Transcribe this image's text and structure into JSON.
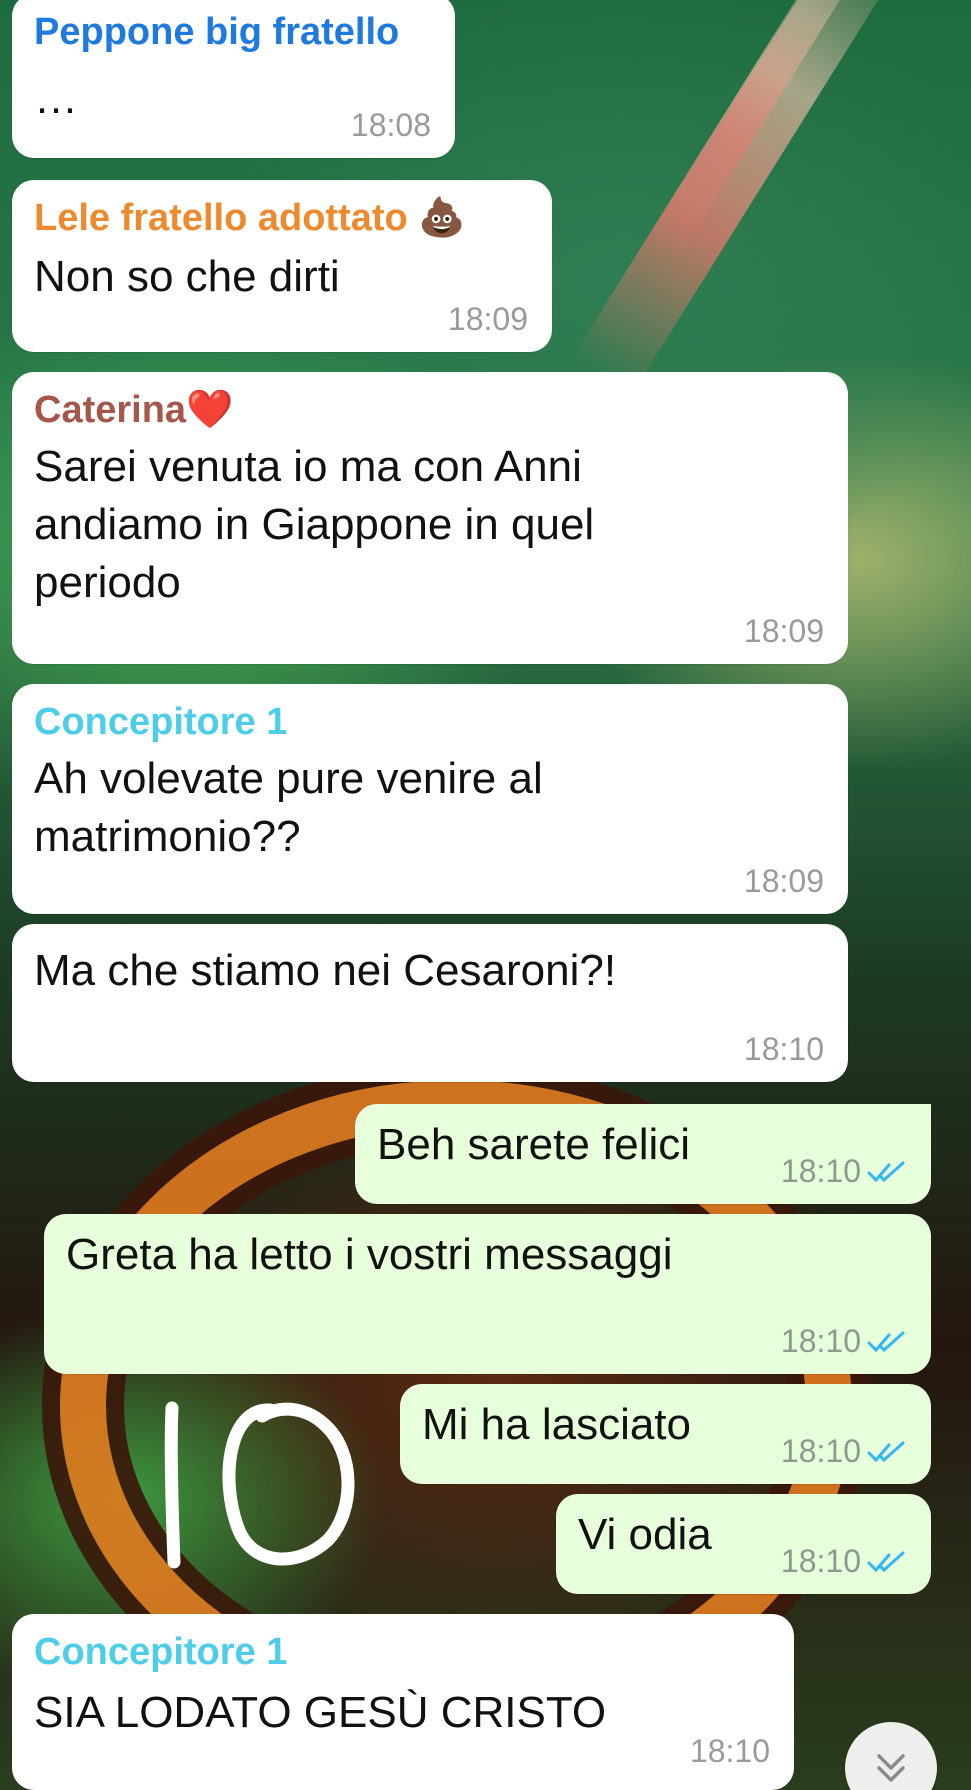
{
  "messages": [
    {
      "id": "m1",
      "sender": "Peppone big fratello",
      "sender_color": "#1f7ae0",
      "text": "…",
      "time": "18:08",
      "direction": "in"
    },
    {
      "id": "m2",
      "sender": "Lele fratello adottato 💩",
      "sender_color": "#ee8a2e",
      "text": "Non so che dirti",
      "time": "18:09",
      "direction": "in"
    },
    {
      "id": "m3",
      "sender": "Caterina❤️",
      "sender_color": "#a4574a",
      "text": "Sarei venuta io ma con Anni\nandiamo in Giappone in quel\nperiodo",
      "time": "18:09",
      "direction": "in"
    },
    {
      "id": "m4",
      "sender": "Concepitore 1",
      "sender_color": "#4ecde8",
      "text": "Ah volevate pure venire al\nmatrimonio??",
      "time": "18:09",
      "direction": "in"
    },
    {
      "id": "m5",
      "sender": "",
      "text": "Ma che stiamo nei Cesaroni?!",
      "time": "18:10",
      "direction": "in"
    },
    {
      "id": "m6",
      "sender": "",
      "text": "Beh sarete felici",
      "time": "18:10",
      "direction": "out",
      "status": "read-ticks-icon"
    },
    {
      "id": "m7",
      "sender": "",
      "text": "Greta ha letto i vostri messaggi",
      "time": "18:10",
      "direction": "out",
      "status": "read-ticks-icon"
    },
    {
      "id": "m8",
      "sender": "",
      "text": "Mi ha lasciato",
      "time": "18:10",
      "direction": "out",
      "status": "read-ticks-icon"
    },
    {
      "id": "m9",
      "sender": "",
      "text": "Vi odia",
      "time": "18:10",
      "direction": "out",
      "status": "read-ticks-icon"
    },
    {
      "id": "m10",
      "sender": "Concepitore 1",
      "sender_color": "#4ecde8",
      "text": "SIA LODATO GESÙ CRISTO",
      "time": "18:10",
      "direction": "in"
    }
  ],
  "colors": {
    "incoming_bubble": "#ffffff",
    "outgoing_bubble": "#e7ffdb",
    "read_ticks": "#34b7f1",
    "timestamp": "#9a9a9a"
  },
  "icons": {
    "scroll_down": "double-chevron-down-icon",
    "doodle": "handwritten-10-doodle"
  }
}
